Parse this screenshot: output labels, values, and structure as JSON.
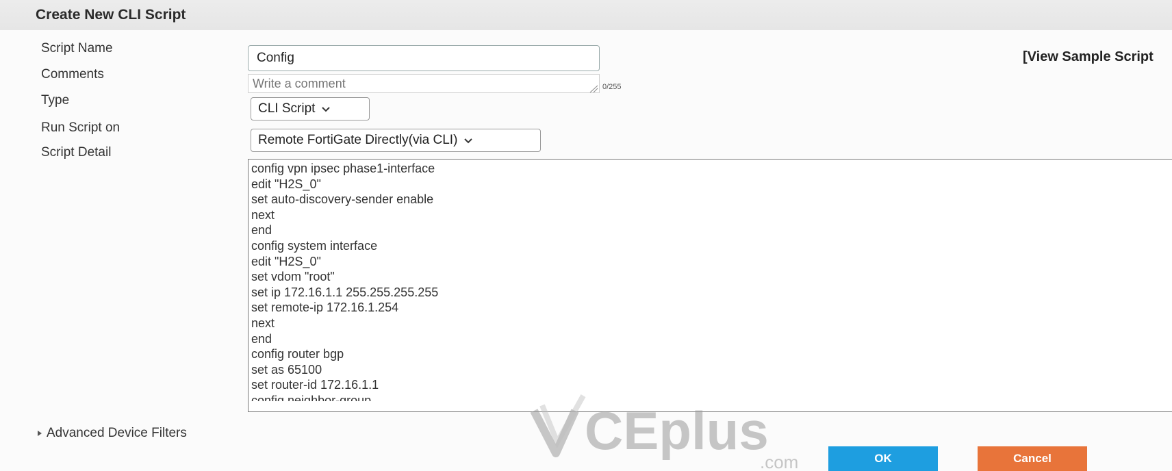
{
  "header": {
    "title": "Create New CLI Script"
  },
  "form": {
    "script_name_label": "Script Name",
    "script_name_value": "Config",
    "comments_label": "Comments",
    "comments_placeholder": "Write a comment",
    "comments_counter": "0/255",
    "type_label": "Type",
    "type_value": "CLI Script",
    "run_on_label": "Run Script on",
    "run_on_value": "Remote FortiGate Directly(via CLI)",
    "script_detail_label": "Script Detail",
    "view_sample_link": "[View Sample Script"
  },
  "script_lines": [
    "config vpn ipsec phase1-interface",
    "edit \"H2S_0\"",
    "set auto-discovery-sender enable",
    "next",
    "end",
    "config system interface",
    "edit \"H2S_0\"",
    "set vdom \"root\"",
    "set ip 172.16.1.1 255.255.255.255",
    "set remote-ip 172.16.1.254",
    "next",
    "end",
    "config router bgp",
    "set as 65100",
    "set router-id 172.16.1.1",
    "config neighbor-group"
  ],
  "advanced_filters_label": "Advanced Device Filters",
  "buttons": {
    "ok": "OK",
    "cancel": "Cancel"
  },
  "watermark": {
    "brand": "CEplus",
    "suffix": ".com"
  }
}
